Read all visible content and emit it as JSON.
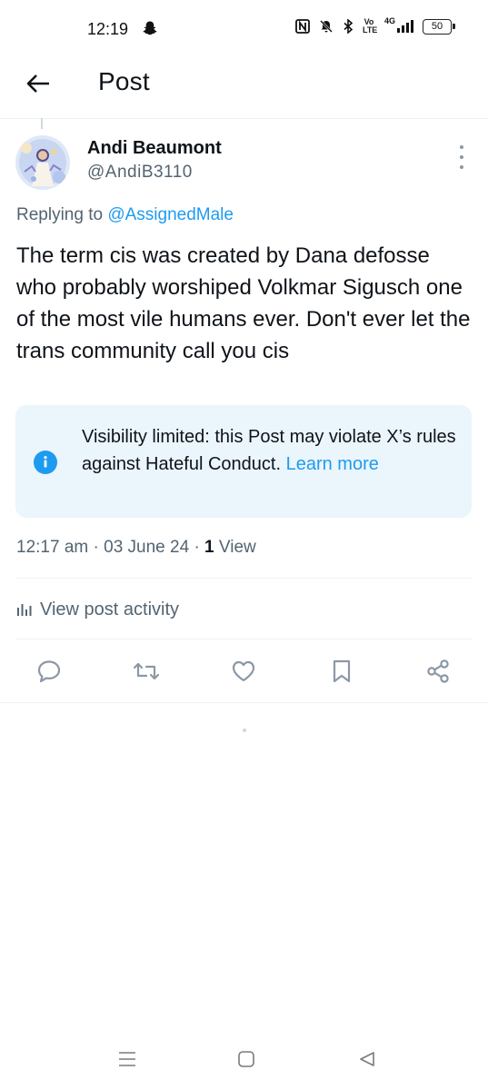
{
  "status_bar": {
    "time": "12:19",
    "network": "4G",
    "volte_label": "Vo LTE",
    "battery": "50"
  },
  "header": {
    "title": "Post"
  },
  "post": {
    "author": {
      "display_name": "Andi Beaumont",
      "handle": "@AndiB3110"
    },
    "replying_prefix": "Replying to",
    "replying_to": "@AssignedMale",
    "text": "The term cis was created by Dana defosse who probably worshiped Volkmar Sigusch one of the most vile humans ever. Don't ever let the trans community call you cis",
    "notice": {
      "text": "Visibility limited: this Post may violate X’s rules against Hateful Conduct.",
      "link": "Learn more"
    },
    "meta": {
      "time": "12:17 am",
      "date": "03 June 24",
      "view_count": "1",
      "view_label": "View"
    },
    "activity_label": "View post activity"
  },
  "colors": {
    "accent": "#1d9bf0",
    "secondary_text": "#536471",
    "notice_bg": "#ebf5fc"
  }
}
